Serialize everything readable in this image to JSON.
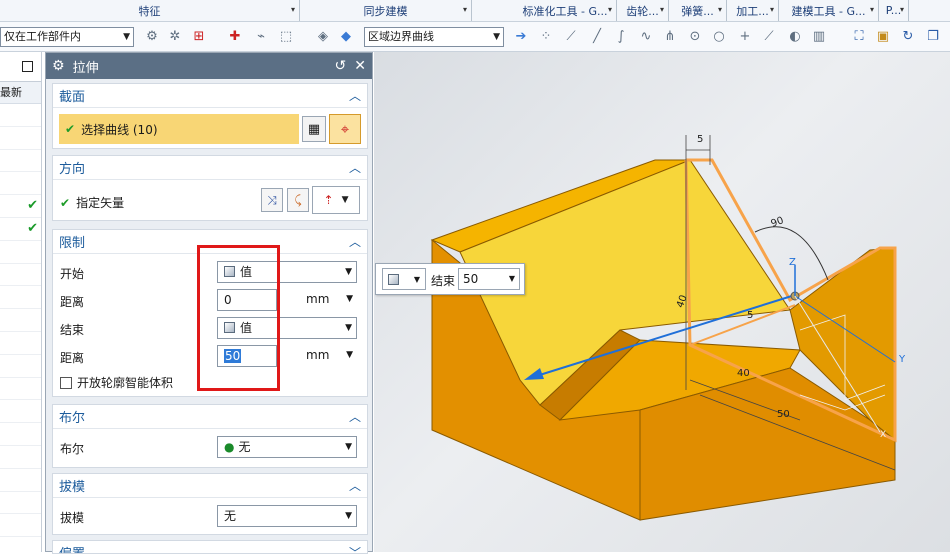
{
  "ribbon": {
    "groups": [
      {
        "label": "特征"
      },
      {
        "label": "同步建模"
      },
      {
        "label": "标准化工具 - G..."
      },
      {
        "label": "齿轮..."
      },
      {
        "label": "弹簧..."
      },
      {
        "label": "加工..."
      },
      {
        "label": "建模工具 - G..."
      },
      {
        "label": "P..."
      }
    ]
  },
  "toolbar": {
    "scope_select": "仅在工作部件内",
    "curve_rule_select": "区域边界曲线"
  },
  "navigator": {
    "column_header": "最新",
    "check_mark": "✔"
  },
  "dialog": {
    "title": "拉伸",
    "section_section": {
      "header": "截面",
      "select_curve_label": "选择曲线 (10)"
    },
    "direction_section": {
      "header": "方向",
      "vector_label": "指定矢量"
    },
    "limits_section": {
      "header": "限制",
      "start_label": "开始",
      "start_value": "值",
      "start_distance_label": "距离",
      "start_distance_value": "0",
      "start_unit": "mm",
      "end_label": "结束",
      "end_value": "值",
      "end_distance_label": "距离",
      "end_distance_value": "50",
      "end_unit": "mm",
      "open_profile_label": "开放轮廓智能体积"
    },
    "boolean_section": {
      "header": "布尔",
      "boolean_label": "布尔",
      "boolean_value": "无"
    },
    "draft_section": {
      "header": "拔模",
      "draft_label": "拔模",
      "draft_value": "无"
    },
    "offset_section": {
      "header": "偏置"
    }
  },
  "viewport": {
    "popup_end_label": "结束",
    "popup_end_value": "50",
    "dims": {
      "d_top": "5",
      "d_angle": "90",
      "d_side": "5",
      "d_mid": "40",
      "d_depth": "40",
      "d_bottom": "50",
      "axis_z": "Z",
      "axis_y": "Y",
      "axis_x": "X"
    }
  },
  "colors": {
    "part_yellow": "#f5b400",
    "part_orange": "#e08d00",
    "face_light": "#f7d63a",
    "selection_orange": "#f7a34a",
    "vector_blue": "#1f6fd8",
    "highlight_red": "#e01818",
    "dialog_title": "#5b6f85"
  }
}
